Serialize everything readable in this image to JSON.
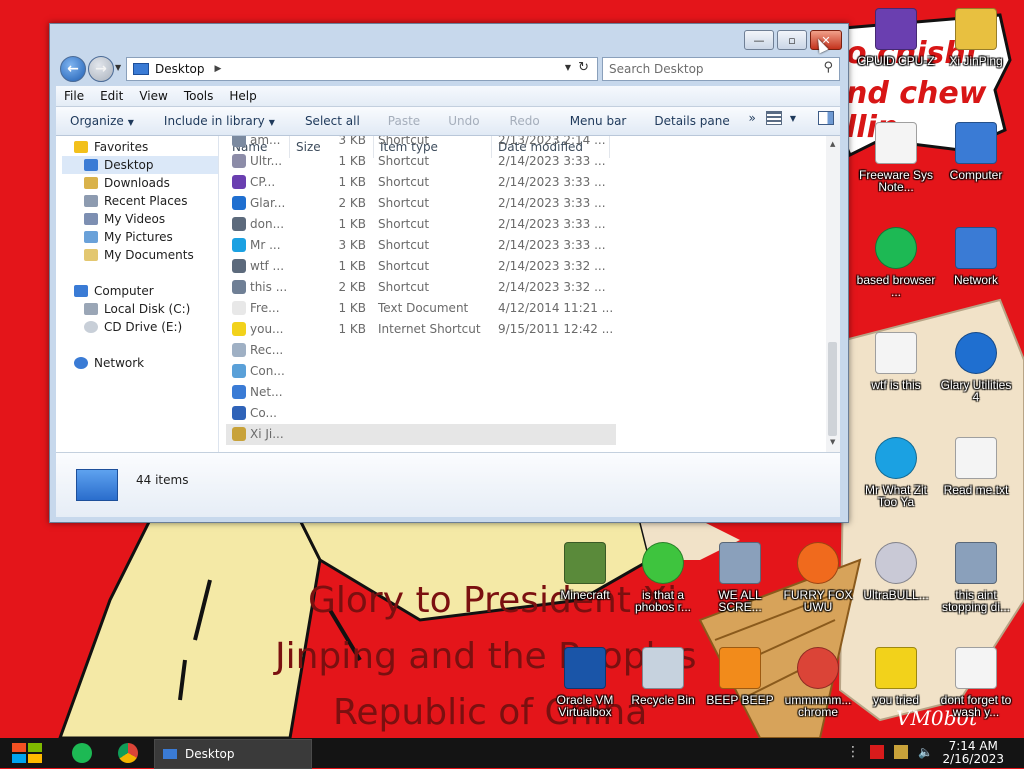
{
  "wallpaper": {
    "caption_lines": [
      "Glory to President Xi",
      "Jinping and the Peoples",
      "Republic of China"
    ],
    "bubble_lines": [
      "o chishi",
      "nd chew",
      "llin"
    ],
    "signature": "VM0b0t"
  },
  "desktop_icons": [
    {
      "label": "CPUID CPU-Z",
      "icon": "cpuz-icon",
      "color": "#6a3fb0"
    },
    {
      "label": "Xi JinPing",
      "icon": "user-shortcut-icon",
      "color": "#e8c040"
    },
    {
      "label": "Freeware Sys Note...",
      "icon": "notepad-icon",
      "color": "#f4f4f4"
    },
    {
      "label": "Computer",
      "icon": "computer-icon",
      "color": "#3a7bd5"
    },
    {
      "label": "based browser ...",
      "icon": "spotify-icon",
      "color": "#1db954"
    },
    {
      "label": "Network",
      "icon": "network-icon",
      "color": "#3a7bd5"
    },
    {
      "label": "wtf is this",
      "icon": "calendar-doc-icon",
      "color": "#f4f4f4"
    },
    {
      "label": "Glary Utilities 4",
      "icon": "glary-icon",
      "color": "#1f6fd0"
    },
    {
      "label": "Mr What Zit Too Ya",
      "icon": "skype-icon",
      "color": "#1ba1e2"
    },
    {
      "label": "Read me.txt",
      "icon": "text-file-icon",
      "color": "#f4f4f4"
    },
    {
      "label": "Minecraft",
      "icon": "minecraft-icon",
      "color": "#5a8a3a"
    },
    {
      "label": "is that a phobos r...",
      "icon": "icq-icon",
      "color": "#3ec43e"
    },
    {
      "label": "WE ALL SCRE...",
      "icon": "computer-error-icon",
      "color": "#8aa0bb"
    },
    {
      "label": "FURRY FOX UWU",
      "icon": "firefox-icon",
      "color": "#f06a1d"
    },
    {
      "label": "UltraBULL...",
      "icon": "disc-icon",
      "color": "#c9c9d6"
    },
    {
      "label": "this aint stopping di...",
      "icon": "pc-scan-icon",
      "color": "#8aa0bb"
    },
    {
      "label": "Oracle VM Virtualbox",
      "icon": "virtualbox-icon",
      "color": "#1a55a8"
    },
    {
      "label": "Recycle Bin",
      "icon": "recycle-bin-icon",
      "color": "#c6d2de"
    },
    {
      "label": "BEEP BEEP",
      "icon": "vlc-icon",
      "color": "#f28b1b"
    },
    {
      "label": "ummmmm... chrome",
      "icon": "chrome-icon",
      "color": "#db4437"
    },
    {
      "label": "you tried",
      "icon": "star-icon",
      "color": "#f2d21b"
    },
    {
      "label": "dont forget to wash y...",
      "icon": "calendar-doc-icon",
      "color": "#f4f4f4"
    }
  ],
  "explorer": {
    "address": "Desktop",
    "search_placeholder": "Search Desktop",
    "menu": [
      "File",
      "Edit",
      "View",
      "Tools",
      "Help"
    ],
    "commands": {
      "organize": "Organize",
      "include": "Include in library",
      "select_all": "Select all",
      "paste": "Paste",
      "undo": "Undo",
      "redo": "Redo",
      "menu_bar": "Menu bar",
      "details_pane": "Details pane",
      "more": "»"
    },
    "nav": {
      "favorites": "Favorites",
      "desktop": "Desktop",
      "downloads": "Downloads",
      "recent": "Recent Places",
      "videos": "My Videos",
      "pictures": "My Pictures",
      "documents": "My Documents",
      "computer": "Computer",
      "local_disk": "Local Disk (C:)",
      "cd_drive": "CD Drive (E:)",
      "network": "Network"
    },
    "columns": [
      "Name",
      "Size",
      "Item type",
      "Date modified"
    ],
    "files": [
      {
        "name": "am...",
        "size": "3 KB",
        "type": "Shortcut",
        "date": "2/13/2023 2:14 ...",
        "icon": "app-icon",
        "color": "#7b8aa0"
      },
      {
        "name": "Ultr...",
        "size": "1 KB",
        "type": "Shortcut",
        "date": "2/14/2023 3:33 ...",
        "icon": "disc-icon",
        "color": "#8c8ca8"
      },
      {
        "name": "CP...",
        "size": "1 KB",
        "type": "Shortcut",
        "date": "2/14/2023 3:33 ...",
        "icon": "cpuz-icon",
        "color": "#6a3fb0"
      },
      {
        "name": "Glar...",
        "size": "2 KB",
        "type": "Shortcut",
        "date": "2/14/2023 3:33 ...",
        "icon": "glary-icon",
        "color": "#1f6fd0"
      },
      {
        "name": "don...",
        "size": "1 KB",
        "type": "Shortcut",
        "date": "2/14/2023 3:33 ...",
        "icon": "calendar-doc-icon",
        "color": "#5c6a7c"
      },
      {
        "name": "Mr ...",
        "size": "3 KB",
        "type": "Shortcut",
        "date": "2/14/2023 3:33 ...",
        "icon": "skype-icon",
        "color": "#1ba1e2"
      },
      {
        "name": "wtf ...",
        "size": "1 KB",
        "type": "Shortcut",
        "date": "2/14/2023 3:32 ...",
        "icon": "calendar-doc-icon",
        "color": "#5c6a7c"
      },
      {
        "name": "this ...",
        "size": "2 KB",
        "type": "Shortcut",
        "date": "2/14/2023 3:32 ...",
        "icon": "pc-scan-icon",
        "color": "#6f7f95"
      },
      {
        "name": "Fre...",
        "size": "1 KB",
        "type": "Text Document",
        "date": "4/12/2014 11:21 ...",
        "icon": "text-file-icon",
        "color": "#e8e8e8"
      },
      {
        "name": "you...",
        "size": "1 KB",
        "type": "Internet Shortcut",
        "date": "9/15/2011 12:42 ...",
        "icon": "star-icon",
        "color": "#f2d21b"
      },
      {
        "name": "Rec...",
        "size": "",
        "type": "",
        "date": "",
        "icon": "recycle-bin-icon",
        "color": "#9fb0c4"
      },
      {
        "name": "Con...",
        "size": "",
        "type": "",
        "date": "",
        "icon": "control-panel-icon",
        "color": "#5aa0d8"
      },
      {
        "name": "Net...",
        "size": "",
        "type": "",
        "date": "",
        "icon": "network-icon",
        "color": "#3a7bd5"
      },
      {
        "name": "Co...",
        "size": "",
        "type": "",
        "date": "",
        "icon": "computer-icon",
        "color": "#2f63b8"
      },
      {
        "name": "Xi Ji...",
        "size": "",
        "type": "",
        "date": "",
        "icon": "user-shortcut-icon",
        "color": "#c8a23a"
      }
    ],
    "item_count": "44 items"
  },
  "taskbar": {
    "active_window": "Desktop",
    "time": "7:14 AM",
    "date": "2/16/2023"
  }
}
